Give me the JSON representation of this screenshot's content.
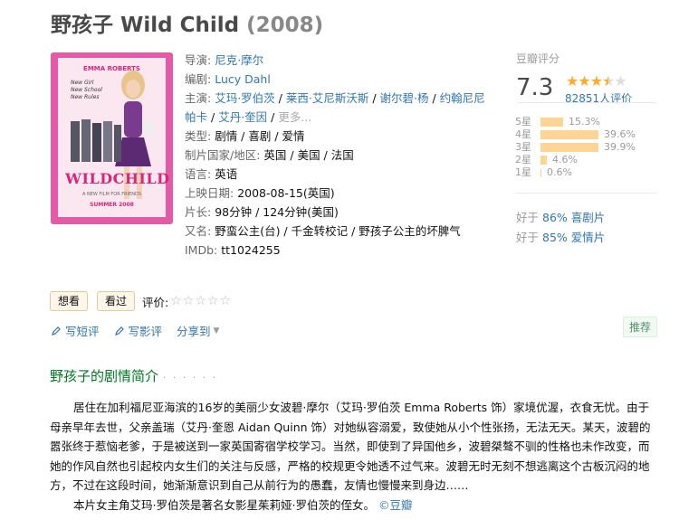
{
  "movie": {
    "title": "野孩子 Wild Child",
    "year": "(2008)"
  },
  "poster": {
    "actor_name": "EMMA ROBERTS",
    "tagline_1": "New Girl",
    "tagline_2": "New School",
    "tagline_3": "New Rules",
    "logo": "WILDCHILD",
    "small": "A NEW FILM FOR FRIENDS",
    "date": "SUMMER 2008"
  },
  "info": {
    "director_label": "导演:",
    "director": "尼克·摩尔",
    "writer_label": "编剧:",
    "writer": "Lucy Dahl",
    "cast_label": "主演:",
    "cast": [
      "艾玛·罗伯茨",
      "莱西·艾尼斯沃斯",
      "谢尔碧·杨",
      "约翰尼尼",
      "帕卡",
      "艾丹·奎因"
    ],
    "more": "更多...",
    "genre_label": "类型:",
    "genre": "剧情 / 喜剧 / 爱情",
    "country_label": "制片国家/地区:",
    "country": "英国 / 美国 / 法国",
    "language_label": "语言:",
    "language": "英语",
    "release_label": "上映日期:",
    "release": "2008-08-15(英国)",
    "runtime_label": "片长:",
    "runtime": "98分钟 / 124分钟(美国)",
    "aka_label": "又名:",
    "aka": "野蛮公主(台) / 千金转校记 / 野孩子公主的坏脾气",
    "imdb_label": "IMDb:",
    "imdb": "tt1024255"
  },
  "rating": {
    "label": "豆瓣评分",
    "score": "7.3",
    "stars_value": 3.5,
    "count": "82851人评价",
    "distribution": [
      {
        "level": "5星",
        "percent": "15.3%",
        "value": 15.3
      },
      {
        "level": "4星",
        "percent": "39.6%",
        "value": 39.6
      },
      {
        "level": "3星",
        "percent": "39.9%",
        "value": 39.9
      },
      {
        "level": "2星",
        "percent": "4.6%",
        "value": 4.6
      },
      {
        "level": "1星",
        "percent": "0.6%",
        "value": 0.6
      }
    ],
    "better_1_prefix": "好于",
    "better_1_pct": "86%",
    "better_1_genre": "喜剧片",
    "better_2_prefix": "好于",
    "better_2_pct": "85%",
    "better_2_genre": "爱情片"
  },
  "actions": {
    "want": "想看",
    "watched": "看过",
    "rate_label": "评价:",
    "rate_stars": "☆☆☆☆☆",
    "short_review": "写短评",
    "review": "写影评",
    "share": "分享到",
    "recommend": "推荐"
  },
  "summary": {
    "title": "野孩子的剧情简介",
    "dots": "· · · · · ·",
    "para1": "居住在加利福尼亚海滨的16岁的美丽少女波碧·摩尔（艾玛·罗伯茨 Emma Roberts 饰）家境优渥，衣食无忧。由于母亲早年去世，父亲盖瑞（艾丹·奎恩 Aidan Quinn 饰）对她纵容溺爱，致使她从小个性张扬，无法无天。某天，波碧的嚣张终于惹恼老爹，于是被送到一家英国寄宿学校学习。当然，即使到了异国他乡，波碧桀骜不驯的性格也未作改变，而她的作风自然也引起校内女生们的关注与反感，严格的校规更令她透不过气来。波碧无时无刻不想逃离这个古板沉闷的地方，不过在这段时间，她渐渐意识到自己从前行为的愚蠢，友情也慢慢来到身边……",
    "para2": "本片女主角艾玛·罗伯茨是著名女影星茱莉娅·罗伯茨的侄女。",
    "source": "©豆瓣"
  },
  "colors": {
    "link": "#3377aa",
    "star": "#ffac2d",
    "bar": "#ffd596",
    "green_title": "#007722"
  }
}
